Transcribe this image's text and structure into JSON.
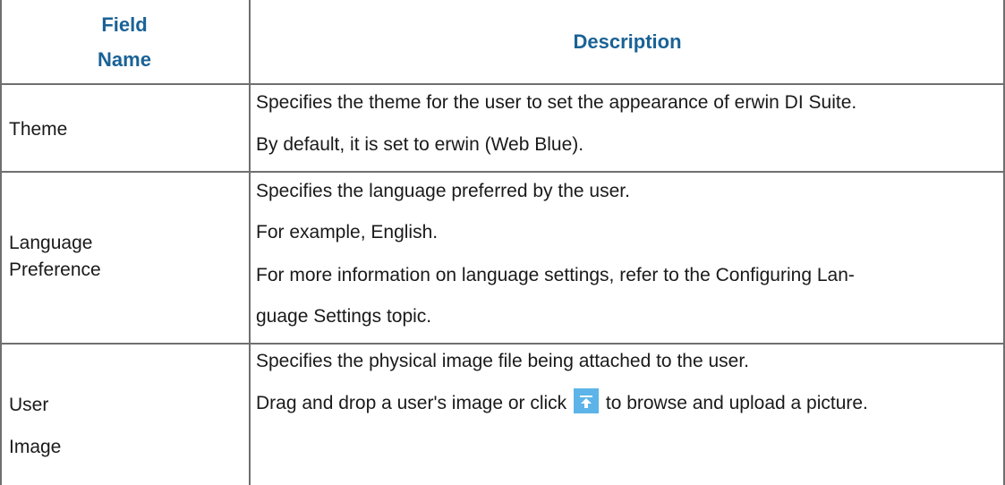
{
  "table": {
    "headers": {
      "field_line1": "Field",
      "field_line2": "Name",
      "description": "Description"
    },
    "rows": [
      {
        "field": [
          "Theme"
        ],
        "description": [
          "Specifies the theme for the user to set the appearance of erwin DI Suite.",
          "By default, it is set to erwin (Web Blue)."
        ]
      },
      {
        "field": [
          "Language",
          "Preference"
        ],
        "description": [
          "Specifies the language preferred by the user.",
          "For example, English.",
          "For more information on language settings, refer to the Configuring Lan-",
          "guage Settings topic."
        ]
      },
      {
        "field": [
          "User",
          "Image"
        ],
        "description": [
          "Specifies the physical image file being attached to the user.",
          "Drag and drop a user's image or click",
          "to browse and upload a picture."
        ],
        "icon": "upload-icon"
      }
    ]
  },
  "colors": {
    "header_text": "#1a6296",
    "border": "#6f6f6f",
    "icon_bg": "#5db4e8"
  }
}
